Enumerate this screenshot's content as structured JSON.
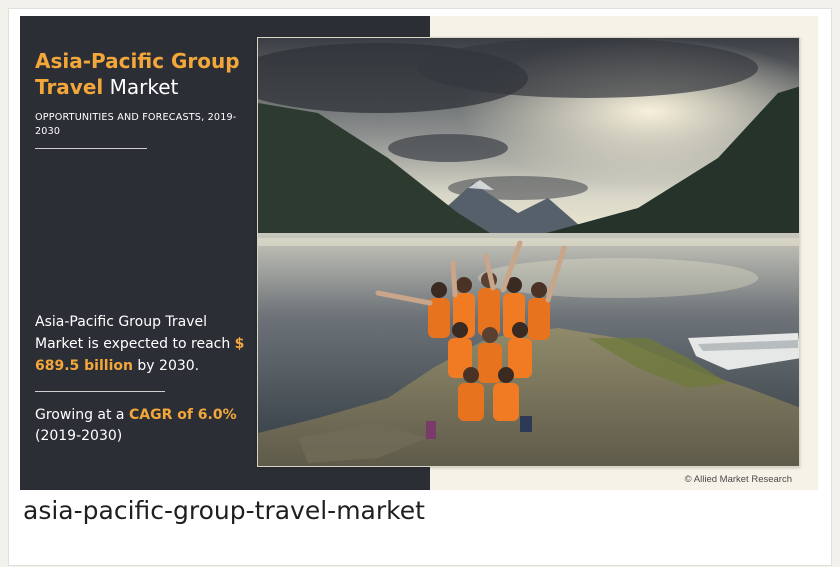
{
  "infographic": {
    "title_line1": "Asia-Pacific Group",
    "title_line2_highlight": "Travel",
    "title_line2_rest": " Market",
    "subtitle": "OPPORTUNITIES AND FORECASTS, 2019-2030",
    "fact_prefix": "Asia-Pacific Group Travel Market is expected to reach ",
    "fact_value": "$ 689.5 billion",
    "fact_suffix": " by 2030.",
    "growth_prefix": "Growing at a ",
    "growth_value": "CAGR of 6.0%",
    "growth_period": "(2019-2030)",
    "credit": "© Allied Market Research",
    "accent_color": "#f3a73a",
    "panel_color": "#2b2f35"
  },
  "caption": "asia-pacific-group-travel-market"
}
